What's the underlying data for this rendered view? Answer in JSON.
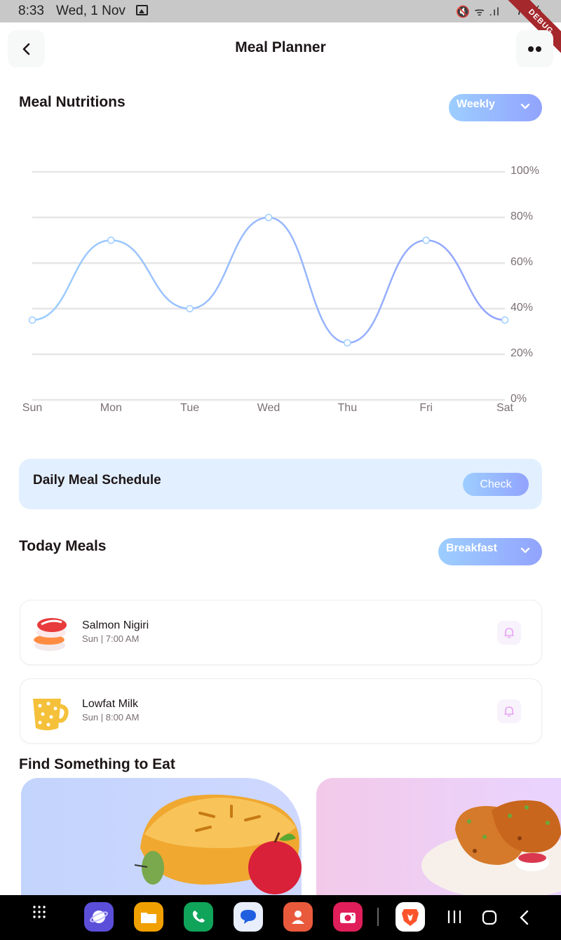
{
  "status_bar": {
    "time": "8:33",
    "date": "Wed, 1 Nov",
    "icons": "🔇 ᯤ .ıl",
    "battery": "79%",
    "debug_label": "DEBUG"
  },
  "header": {
    "title": "Meal Planner"
  },
  "nutrition": {
    "title": "Meal Nutritions",
    "period": "Weekly"
  },
  "chart_data": {
    "type": "line",
    "categories": [
      "Sun",
      "Mon",
      "Tue",
      "Wed",
      "Thu",
      "Fri",
      "Sat"
    ],
    "values": [
      35,
      70,
      40,
      80,
      25,
      70,
      35
    ],
    "y_ticks": [
      "0%",
      "20%",
      "40%",
      "60%",
      "80%",
      "100%"
    ],
    "ylim": [
      0,
      100
    ],
    "grid": true,
    "line_color": "#92a3fd",
    "point_fill": "#ffffff"
  },
  "schedule": {
    "title": "Daily Meal Schedule",
    "button": "Check"
  },
  "today_meals": {
    "title": "Today Meals",
    "filter": "Breakfast",
    "items": [
      {
        "name": "Salmon Nigiri",
        "time": "Sun | 7:00 AM"
      },
      {
        "name": "Lowfat Milk",
        "time": "Sun | 8:00 AM"
      }
    ]
  },
  "find": {
    "title": "Find Something to Eat"
  },
  "colors": {
    "brand_blue_start": "#9dceff",
    "brand_blue_end": "#92a3fd",
    "text_dark": "#1d1617",
    "text_gray": "#7b6f72",
    "bell_color": "#c58bf2"
  }
}
